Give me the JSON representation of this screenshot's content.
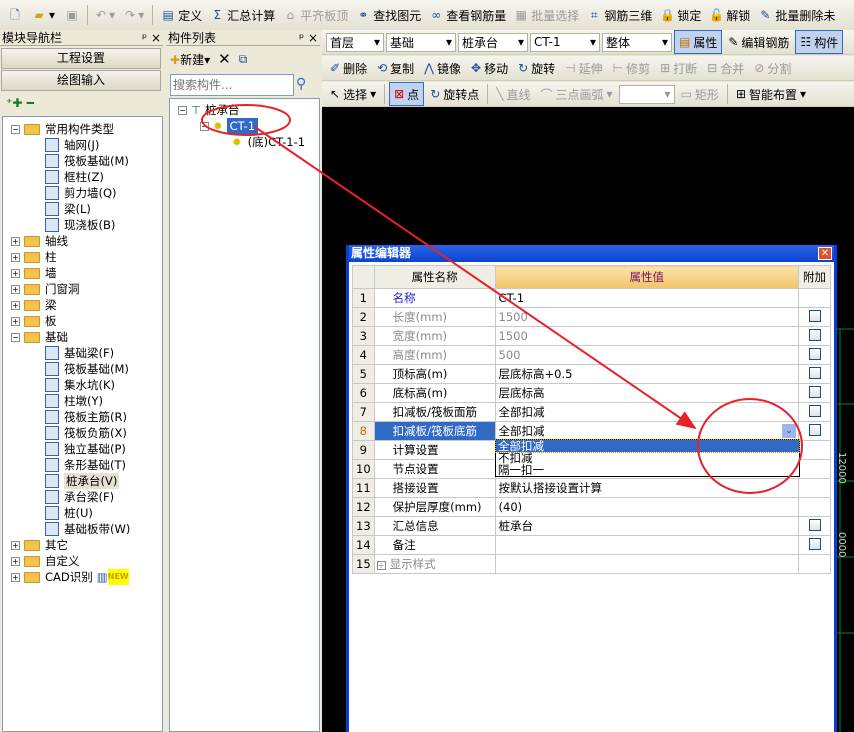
{
  "toolbar": {
    "items": [
      {
        "icon": "define-icon",
        "label": "定义",
        "enabled": true
      },
      {
        "icon": "sigma-icon",
        "label": "汇总计算",
        "enabled": true
      },
      {
        "icon": "align-slab-top-icon",
        "label": "平齐板顶",
        "enabled": false
      },
      {
        "icon": "binoculars-icon",
        "label": "查找图元",
        "enabled": true
      },
      {
        "icon": "glasses-icon",
        "label": "查看钢筋量",
        "enabled": true
      },
      {
        "icon": "batch-select-icon",
        "label": "批量选择",
        "enabled": false
      },
      {
        "icon": "rebar-3d-icon",
        "label": "钢筋三维",
        "enabled": true
      },
      {
        "icon": "lock-icon",
        "label": "锁定",
        "enabled": true
      },
      {
        "icon": "unlock-icon",
        "label": "解锁",
        "enabled": true
      },
      {
        "icon": "batch-delete-icon",
        "label": "批量删除未",
        "enabled": true
      }
    ]
  },
  "nav": {
    "title": "模块导航栏",
    "btn_project": "工程设置",
    "btn_draw": "绘图输入",
    "tree": [
      {
        "label": "常用构件类型",
        "open": true,
        "children": [
          "轴网(J)",
          "筏板基础(M)",
          "框柱(Z)",
          "剪力墙(Q)",
          "梁(L)",
          "现浇板(B)"
        ]
      },
      {
        "label": "轴线"
      },
      {
        "label": "柱"
      },
      {
        "label": "墙"
      },
      {
        "label": "门窗洞"
      },
      {
        "label": "梁"
      },
      {
        "label": "板"
      },
      {
        "label": "基础",
        "open": true,
        "children": [
          "基础梁(F)",
          "筏板基础(M)",
          "集水坑(K)",
          "柱墩(Y)",
          "筏板主筋(R)",
          "筏板负筋(X)",
          "独立基础(P)",
          "条形基础(T)",
          "桩承台(V)",
          "承台梁(F)",
          "桩(U)",
          "基础板带(W)"
        ]
      },
      {
        "label": "其它"
      },
      {
        "label": "自定义"
      },
      {
        "label": "CAD识别",
        "badge": "NEW"
      }
    ],
    "selected_child": "桩承台(V)"
  },
  "complist": {
    "title": "构件列表",
    "new_label": "新建",
    "search_placeholder": "搜索构件...",
    "root": "桩承台",
    "item": "CT-1",
    "sub": "(底)CT-1-1"
  },
  "selectors": {
    "floor": "首层",
    "category": "基础",
    "type": "桩承台",
    "name": "CT-1",
    "scope": "整体",
    "prop_btn": "属性",
    "edit_rebar": "编辑钢筋",
    "comp_btn": "构件"
  },
  "edit_toolbar": [
    "删除",
    "复制",
    "镜像",
    "移动",
    "旋转",
    "延伸",
    "修剪",
    "打断",
    "合并",
    "分割"
  ],
  "draw_toolbar": {
    "select": "选择",
    "point": "点",
    "rotate_point": "旋转点",
    "line": "直线",
    "arc": "三点画弧",
    "rect": "矩形",
    "smart": "智能布置"
  },
  "canvas": {
    "dims": [
      "12000",
      "0000"
    ]
  },
  "dialog": {
    "title": "属性编辑器",
    "headers": [
      "属性名称",
      "属性值",
      "附加"
    ],
    "rows": [
      {
        "n": "1",
        "name": "名称",
        "value": "CT-1",
        "cb": false
      },
      {
        "n": "2",
        "name": "长度(mm)",
        "value": "1500",
        "cb": true
      },
      {
        "n": "3",
        "name": "宽度(mm)",
        "value": "1500",
        "cb": true
      },
      {
        "n": "4",
        "name": "高度(mm)",
        "value": "500",
        "cb": true
      },
      {
        "n": "5",
        "name": "顶标高(m)",
        "value": "层底标高+0.5",
        "cb": true
      },
      {
        "n": "6",
        "name": "底标高(m)",
        "value": "层底标高",
        "cb": true
      },
      {
        "n": "7",
        "name": "扣减板/筏板面筋",
        "value": "全部扣减",
        "cb": true
      },
      {
        "n": "8",
        "name": "扣减板/筏板底筋",
        "value": "全部扣减",
        "cb": true
      },
      {
        "n": "9",
        "name": "计算设置",
        "value": "",
        "cb": false
      },
      {
        "n": "10",
        "name": "节点设置",
        "value": "",
        "cb": false
      },
      {
        "n": "11",
        "name": "搭接设置",
        "value": "按默认搭接设置计算",
        "cb": false
      },
      {
        "n": "12",
        "name": "保护层厚度(mm)",
        "value": "(40)",
        "cb": false
      },
      {
        "n": "13",
        "name": "汇总信息",
        "value": "桩承台",
        "cb": true
      },
      {
        "n": "14",
        "name": "备注",
        "value": "",
        "cb": true
      },
      {
        "n": "15",
        "name": "显示样式",
        "value": "",
        "cb": false
      }
    ],
    "dropdown_options": [
      "全部扣减",
      "不扣减",
      "隔一扣一"
    ],
    "dropdown_selected": 0
  },
  "colors": {
    "annotation": "#e8202a",
    "selection": "#316ac5",
    "title_bar": "#0a3cd6"
  }
}
